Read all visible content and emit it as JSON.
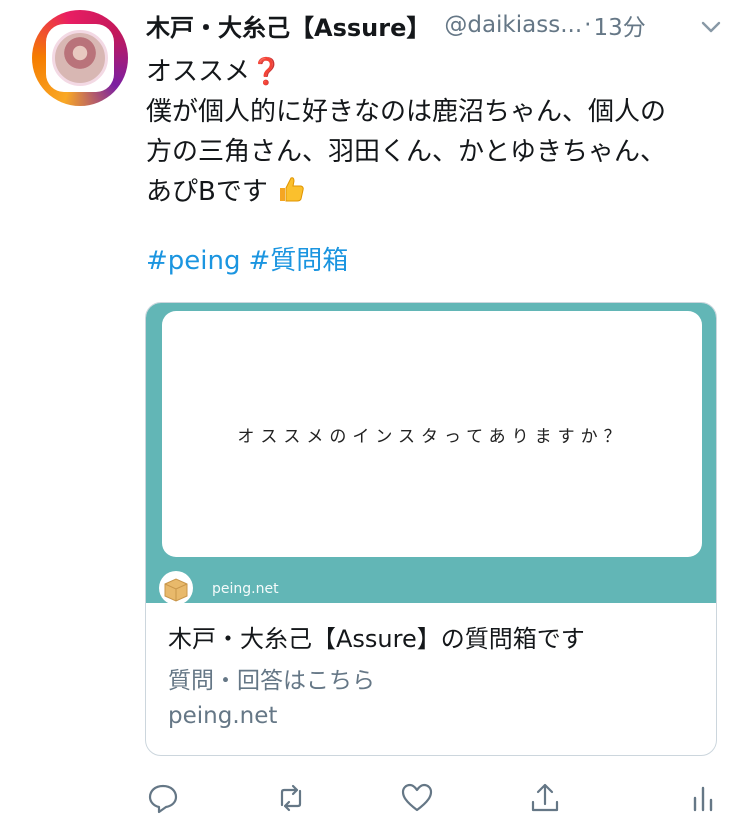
{
  "tweet": {
    "author_name": "木戸・大糸己【Assure】",
    "handle": "@daikiass...",
    "separator": "·",
    "time": "13分",
    "body_line1": "オススメ",
    "body_line2": "僕が個人的に好きなのは鹿沼ちゃん、個人の",
    "body_line3": "方の三角さん、羽田くん、かとゆきちゃん、",
    "body_line4": "あぴBです",
    "hashtags": [
      "#peing",
      "#質問箱"
    ]
  },
  "card": {
    "question": "オススメのインスタってありますか？",
    "site_small": "peing.net",
    "title": "木戸・大糸己【Assure】の質問箱です",
    "description": "質問・回答はこちら",
    "domain": "peing.net",
    "accent_color": "#62b6b6"
  },
  "icons": {
    "avatar": "instagram-style-avatar",
    "more": "chevron-down-icon",
    "reply": "reply-icon",
    "retweet": "retweet-icon",
    "like": "heart-icon",
    "share": "share-icon",
    "analytics": "analytics-icon"
  },
  "colors": {
    "link": "#1b95e0",
    "secondary_text": "#657786",
    "primary_text": "#14171a"
  }
}
